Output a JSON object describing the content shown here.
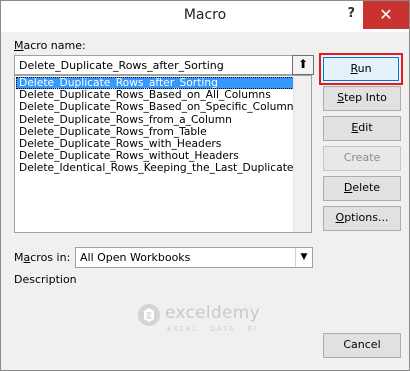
{
  "window": {
    "title": "Macro",
    "help_glyph": "?",
    "close_glyph": "✕"
  },
  "macro_name": {
    "label": "Macro name:",
    "value": "Delete_Duplicate_Rows_after_Sorting",
    "up_glyph": "⬆"
  },
  "macros": [
    {
      "label": "Delete_Duplicate_Rows_after_Sorting",
      "selected": true
    },
    {
      "label": "Delete_Duplicate_Rows_Based_on_All_Columns",
      "selected": false
    },
    {
      "label": "Delete_Duplicate_Rows_Based_on_Specific_Columns",
      "selected": false
    },
    {
      "label": "Delete_Duplicate_Rows_from_a_Column",
      "selected": false
    },
    {
      "label": "Delete_Duplicate_Rows_from_Table",
      "selected": false
    },
    {
      "label": "Delete_Duplicate_Rows_with_Headers",
      "selected": false
    },
    {
      "label": "Delete_Duplicate_Rows_without_Headers",
      "selected": false
    },
    {
      "label": "Delete_Identical_Rows_Keeping_the_Last_Duplicate",
      "selected": false
    }
  ],
  "buttons": {
    "run": "Run",
    "step_into": "Step Into",
    "edit": "Edit",
    "create": "Create",
    "delete": "Delete",
    "options": "Options...",
    "cancel": "Cancel"
  },
  "macros_in": {
    "label": "Macros in:",
    "value": "All Open Workbooks",
    "arrow_glyph": "⌄"
  },
  "description": {
    "label": "Description"
  },
  "watermark": {
    "name": "exceldemy",
    "tagline": "EXCEL · DATA · BI"
  },
  "colors": {
    "highlight": "#e01a22",
    "selection": "#3399ff",
    "close": "#c8322f"
  }
}
